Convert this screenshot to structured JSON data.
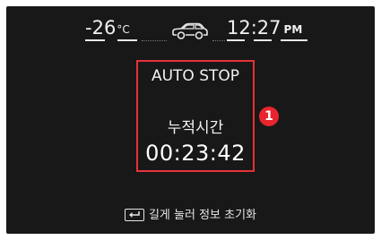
{
  "status_bar": {
    "temperature_value": "-26",
    "temperature_unit": "°C",
    "car_icon": "car-outline-icon",
    "time": "12:27",
    "ampm": "PM"
  },
  "auto_stop": {
    "title": "AUTO STOP",
    "label": "누적시간",
    "time": "00:23:42"
  },
  "callout": {
    "number": "1",
    "color": "#e8252f"
  },
  "hint": {
    "icon": "enter-key-icon",
    "text": "길게 눌러 정보 초기화"
  },
  "colors": {
    "background": "#181818",
    "text": "#f2f2f2",
    "highlight_border": "#e53238"
  }
}
